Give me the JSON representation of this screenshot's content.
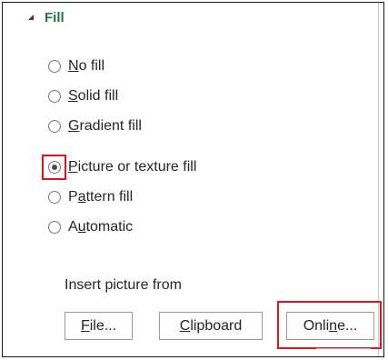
{
  "section": {
    "title": "Fill"
  },
  "options": [
    {
      "pre": "",
      "key": "N",
      "post": "o fill",
      "checked": false
    },
    {
      "pre": "",
      "key": "S",
      "post": "olid fill",
      "checked": false
    },
    {
      "pre": "",
      "key": "G",
      "post": "radient fill",
      "checked": false
    },
    {
      "pre": "",
      "key": "P",
      "post": "icture or texture fill",
      "checked": true
    },
    {
      "pre": "P",
      "key": "a",
      "post": "ttern fill",
      "checked": false
    },
    {
      "pre": "A",
      "key": "u",
      "post": "tomatic",
      "checked": false
    }
  ],
  "insert": {
    "label": "Insert picture from",
    "file_btn": {
      "key": "F",
      "post": "ile..."
    },
    "clipboard_btn": {
      "key": "C",
      "post": "lipboard"
    },
    "online_btn": {
      "pre": "Onli",
      "key": "n",
      "post": "e..."
    }
  },
  "colors": {
    "accent": "#217346",
    "highlight": "#e3121b"
  }
}
